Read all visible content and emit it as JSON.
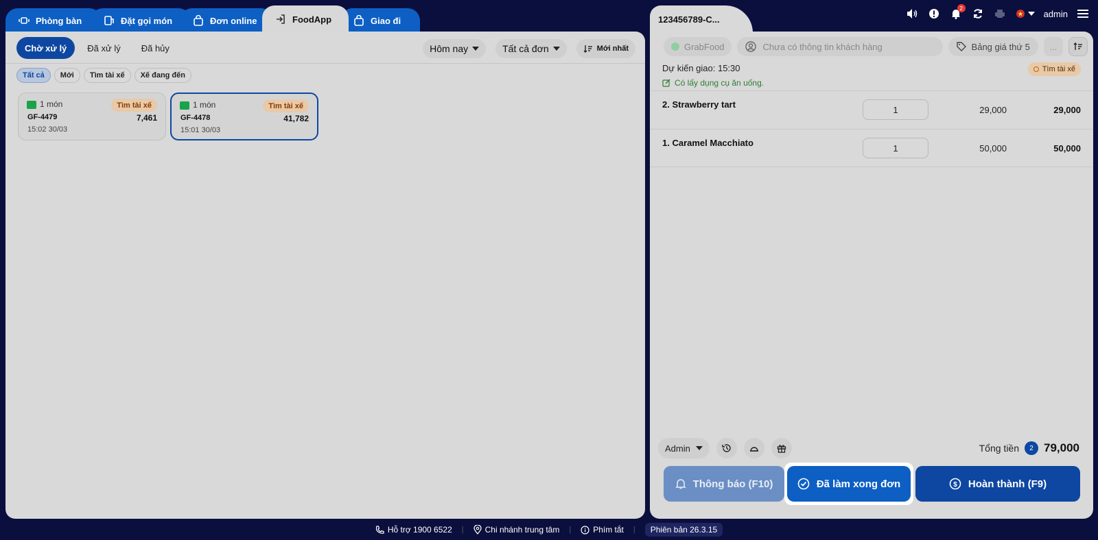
{
  "tabs": [
    {
      "label": "Phòng bàn",
      "icon": "table-icon"
    },
    {
      "label": "Đặt gọi món",
      "icon": "order-icon"
    },
    {
      "label": "Đơn online",
      "icon": "bag-icon"
    },
    {
      "label": "FoodApp",
      "icon": "login-icon"
    },
    {
      "label": "Giao đi",
      "icon": "bag-icon"
    }
  ],
  "left": {
    "subtabs": [
      "Chờ xử lý",
      "Đã xử lý",
      "Đã hủy"
    ],
    "date_filter": "Hôm nay",
    "order_filter": "Tất cả đơn",
    "sort_label": "Mới nhất",
    "chips": [
      "Tất cả",
      "Mới",
      "Tìm tài xế",
      "Xế đang đến"
    ],
    "cards": [
      {
        "items": "1 món",
        "badge": "Tìm tài xế",
        "code": "GF-4479",
        "amount": "7,461",
        "time": "15:02 30/03"
      },
      {
        "items": "1 món",
        "badge": "Tìm tài xế",
        "code": "GF-4478",
        "amount": "41,782",
        "time": "15:01 30/03"
      }
    ]
  },
  "right": {
    "order_tab": "123456789-C...",
    "notif_count": "2",
    "user": "admin",
    "source": "GrabFood",
    "customer_placeholder": "Chưa có thông tin khách hàng",
    "price_list": "Bảng giá thứ 5",
    "more": "...",
    "delivery": "Dự kiến giao: 15:30",
    "utensils": "Có lấy dụng cụ ăn uống.",
    "status_badge": "Tìm tài xế",
    "lines": [
      {
        "name": "2. Strawberry tart",
        "qty": "1",
        "unit_price": "29,000",
        "total": "29,000"
      },
      {
        "name": "1. Caramel Macchiato",
        "qty": "1",
        "unit_price": "50,000",
        "total": "50,000"
      }
    ],
    "staff": "Admin",
    "total_label": "Tổng tiền",
    "total_count": "2",
    "total_value": "79,000",
    "btn_notify": "Thông báo (F10)",
    "btn_done": "Đã làm xong đơn",
    "btn_complete": "Hoàn thành (F9)"
  },
  "footer": {
    "support": "Hỗ trợ 1900 6522",
    "branch": "Chi nhánh trung tâm",
    "shortcuts": "Phím tắt",
    "version": "Phiên bản 26.3.15"
  }
}
